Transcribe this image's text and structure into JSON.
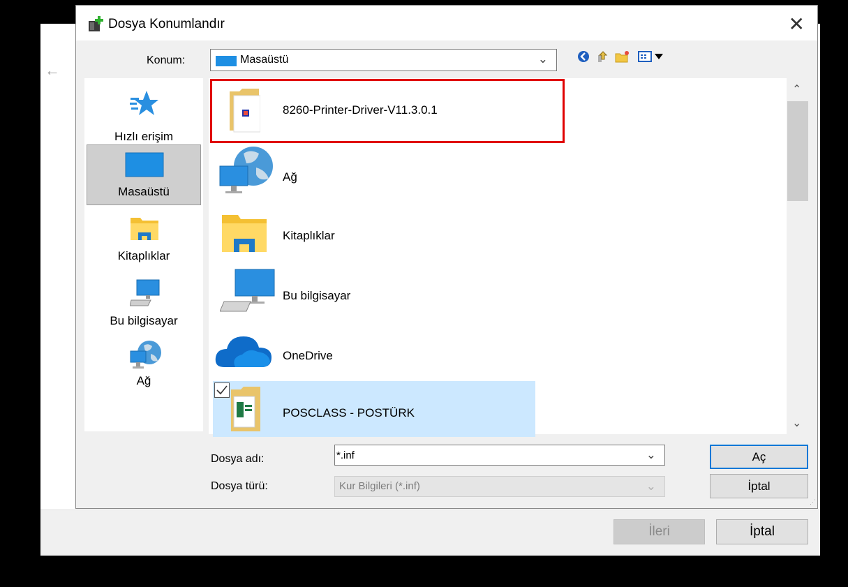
{
  "dialog": {
    "title": "Dosya Konumlandır",
    "close_icon": "close-icon"
  },
  "location": {
    "label": "Konum:",
    "value": "Masaüstü"
  },
  "toolbar": {
    "icons": [
      "back-icon",
      "up-folder-icon",
      "new-folder-icon",
      "view-menu-icon"
    ]
  },
  "sidebar": {
    "items": [
      {
        "label": "Hızlı erişim",
        "icon": "star-icon"
      },
      {
        "label": "Masaüstü",
        "icon": "desktop-icon",
        "selected": true
      },
      {
        "label": "Kitaplıklar",
        "icon": "libraries-icon"
      },
      {
        "label": "Bu bilgisayar",
        "icon": "computer-icon"
      },
      {
        "label": "Ağ",
        "icon": "network-icon"
      }
    ]
  },
  "files": [
    {
      "name": "8260-Printer-Driver-V11.3.0.1",
      "icon": "folder-icon",
      "highlighted": true
    },
    {
      "name": "Ağ",
      "icon": "network-icon"
    },
    {
      "name": "Kitaplıklar",
      "icon": "libraries-icon"
    },
    {
      "name": "Bu bilgisayar",
      "icon": "computer-icon"
    },
    {
      "name": "OneDrive",
      "icon": "cloud-icon"
    },
    {
      "name": "POSCLASS - POSTÜRK",
      "icon": "folder-icon",
      "selected": true,
      "checked": true
    }
  ],
  "fields": {
    "filename_label": "Dosya adı:",
    "filename_value": "*.inf",
    "filetype_label": "Dosya türü:",
    "filetype_value": "Kur Bilgileri (*.inf)"
  },
  "buttons": {
    "open": "Aç",
    "cancel": "İptal"
  },
  "wizard": {
    "next": "İleri",
    "cancel": "İptal"
  },
  "colors": {
    "accent": "#0078d7",
    "selection": "#cce8ff",
    "highlight_box": "#e00000",
    "desktop_blue": "#1e8fe3"
  }
}
